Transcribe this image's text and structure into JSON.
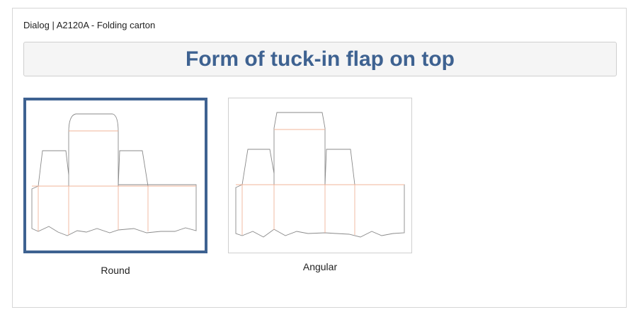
{
  "dialog": {
    "title": "Dialog | A2120A - Folding carton",
    "heading": "Form of tuck-in flap on top"
  },
  "options": [
    {
      "label": "Round",
      "selected": true,
      "image_icon": "round-tuck-flap-dieline-icon"
    },
    {
      "label": "Angular",
      "selected": false,
      "image_icon": "angular-tuck-flap-dieline-icon"
    }
  ],
  "colors": {
    "accent": "#3e6291",
    "cut_line": "#8a8a8a",
    "fold_line": "#f0b49a",
    "heading_bg": "#f5f5f5"
  }
}
